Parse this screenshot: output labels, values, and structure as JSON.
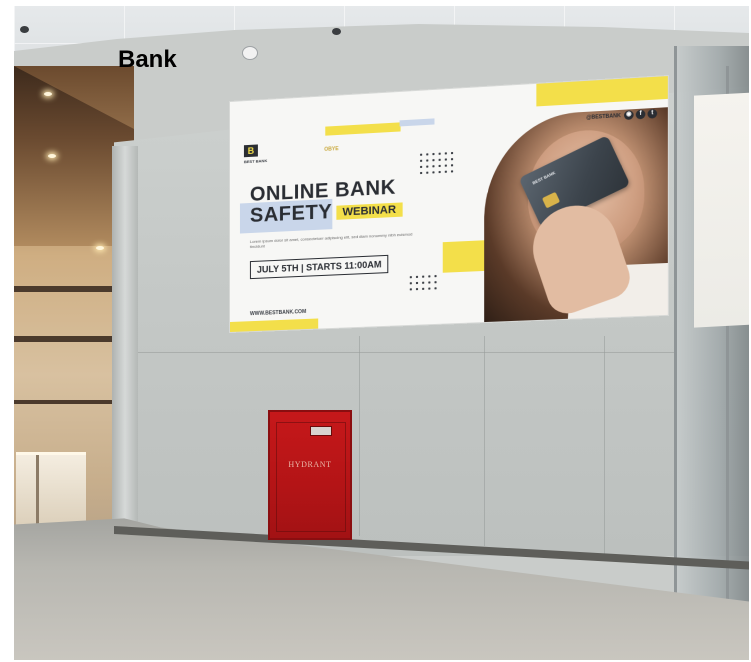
{
  "caption": "Bank",
  "billboard": {
    "brand": "BEST BANK",
    "logo_letter": "B",
    "code": "OBYE",
    "title_line1": "ONLINE BANK",
    "title_line2": "SAFETY",
    "tag": "WEBINAR",
    "body": "Lorem ipsum dolor sit amet, consectetuer adipiscing elit, sed diam nonummy nibh euismod tincidunt",
    "date": "JULY 5TH | STARTS 11:00AM",
    "handle": "@BESTBANK",
    "url": "WWW.BESTBANK.COM",
    "card_label": "BEST BANK",
    "accent_color": "#f3df4a"
  },
  "hydrant": {
    "label": "HYDRANT",
    "color": "#c6181a"
  }
}
